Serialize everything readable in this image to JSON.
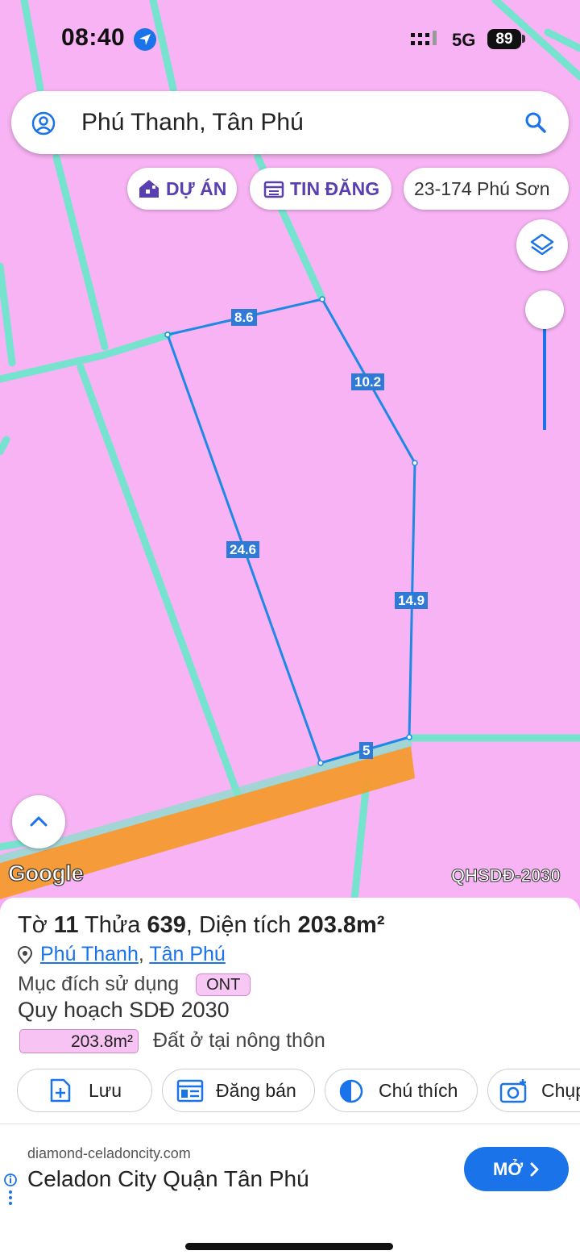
{
  "status_bar": {
    "time": "08:40",
    "network": "5G",
    "battery": "89"
  },
  "search": {
    "query": "Phú Thanh, Tân Phú"
  },
  "chips": {
    "projects": "DỰ ÁN",
    "listings": "TIN ĐĂNG",
    "nearby": "23-174 Phú Sơn"
  },
  "map": {
    "edge_labels": [
      "8.6",
      "10.2",
      "24.6",
      "14.9",
      "5"
    ],
    "attribution": "Google",
    "layer_tag": "QHSDĐ-2030",
    "colors": {
      "land": "#f7b3f3",
      "roads": "#76e3cf",
      "main_road": "#f5a23a",
      "boundary": "#1e88e5"
    }
  },
  "parcel": {
    "sheet_label": "Tờ",
    "sheet": "11",
    "plot_label": "Thửa",
    "plot": "639",
    "area_label": ", Diện tích",
    "area": "203.8m²",
    "ward": "Phú Thanh",
    "district": "Tân Phú",
    "separator": ", ",
    "purpose_label": "Mục đích sử dụng",
    "purpose_code": "ONT",
    "plan_label": "Quy hoạch SDĐ 2030",
    "plan_area": "203.8m²",
    "land_use": "Đất ở tại nông thôn"
  },
  "actions": {
    "save": "Lưu",
    "post_sale": "Đăng bán",
    "legend": "Chú thích",
    "capture": "Chụp"
  },
  "ad": {
    "domain": "diamond-celadoncity.com",
    "title": "Celadon City Quận Tân Phú",
    "open": "MỞ"
  }
}
